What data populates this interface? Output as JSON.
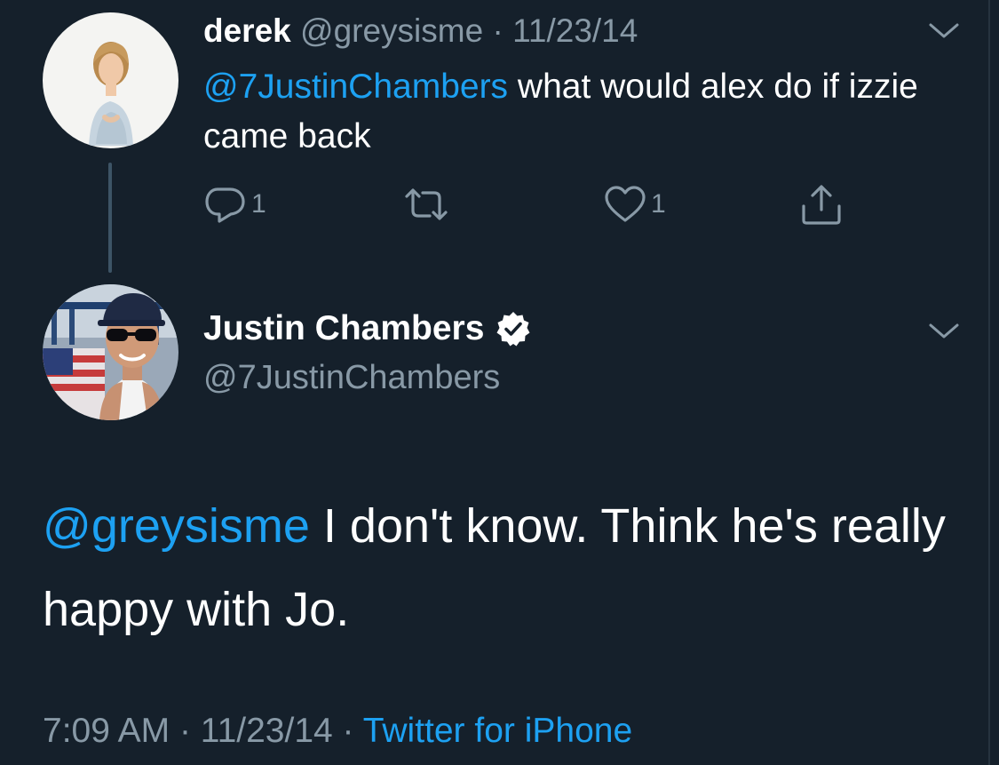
{
  "tweet1": {
    "display_name": "derek",
    "handle": "@greysisme",
    "separator": "·",
    "date": "11/23/14",
    "mention": "@7JustinChambers",
    "text": "what would alex do if izzie came back",
    "reply_count": "1",
    "retweet_count": "",
    "like_count": "1"
  },
  "tweet2": {
    "display_name": "Justin Chambers",
    "handle": "@7JustinChambers",
    "verified": true,
    "mention": "@greysisme",
    "text": "I don't know. Think he's really happy with Jo.",
    "time": "7:09 AM",
    "separator1": "·",
    "date": "11/23/14",
    "separator2": "·",
    "source": "Twitter for iPhone"
  },
  "icons": {
    "reply": "reply-icon",
    "retweet": "retweet-icon",
    "like": "heart-icon",
    "share": "share-icon",
    "caret": "chevron-down-icon",
    "verified": "verified-badge-icon"
  },
  "colors": {
    "background": "#15202b",
    "text": "#ffffff",
    "secondary": "#8899a6",
    "link": "#1da1f2",
    "thread_line": "#3d5466"
  }
}
